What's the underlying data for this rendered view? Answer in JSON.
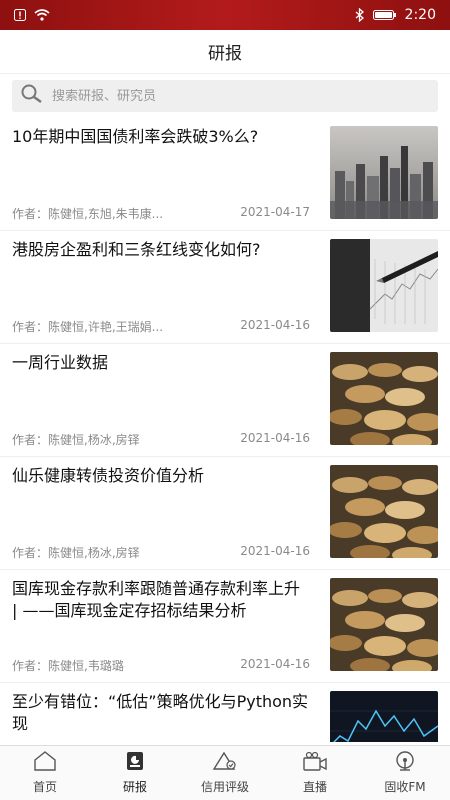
{
  "status_bar": {
    "time": "2:20",
    "left_icons": [
      "alert-icon",
      "wifi-icon"
    ],
    "right_icons": [
      "bluetooth-icon",
      "battery-icon"
    ]
  },
  "header": {
    "title": "研报"
  },
  "search": {
    "placeholder": "搜索研报、研究员"
  },
  "colors": {
    "status_bar": "#a31515",
    "text": "#111111",
    "meta": "#8a8a8a"
  },
  "reports": [
    {
      "title": "10年期中国国债利率会跌破3%么?",
      "author": "作者：陈健恒,东旭,朱韦康...",
      "date": "2021-04-17",
      "thumb": "city-photo"
    },
    {
      "title": "港股房企盈利和三条红线变化如何?",
      "author": "作者：陈健恒,许艳,王瑞娟...",
      "date": "2021-04-16",
      "thumb": "pen-chart-photo"
    },
    {
      "title": "一周行业数据",
      "author": "作者：陈健恒,杨冰,房铎",
      "date": "2021-04-16",
      "thumb": "coins-photo"
    },
    {
      "title": "仙乐健康转债投资价值分析",
      "author": "作者：陈健恒,杨冰,房铎",
      "date": "2021-04-16",
      "thumb": "coins-photo"
    },
    {
      "title": "国库现金存款利率跟随普通存款利率上升 | ——国库现金定存招标结果分析",
      "author": "作者：陈健恒,韦璐璐",
      "date": "2021-04-16",
      "thumb": "coins-photo"
    },
    {
      "title": "至少有错位：“低估”策略优化与Python实现",
      "author": "",
      "date": "",
      "thumb": "trading-chart-photo"
    }
  ],
  "tabs": [
    {
      "label": "首页",
      "icon": "home-icon"
    },
    {
      "label": "研报",
      "icon": "report-icon",
      "active": true
    },
    {
      "label": "信用评级",
      "icon": "rating-icon"
    },
    {
      "label": "直播",
      "icon": "camera-icon"
    },
    {
      "label": "固收FM",
      "icon": "radio-icon"
    }
  ]
}
